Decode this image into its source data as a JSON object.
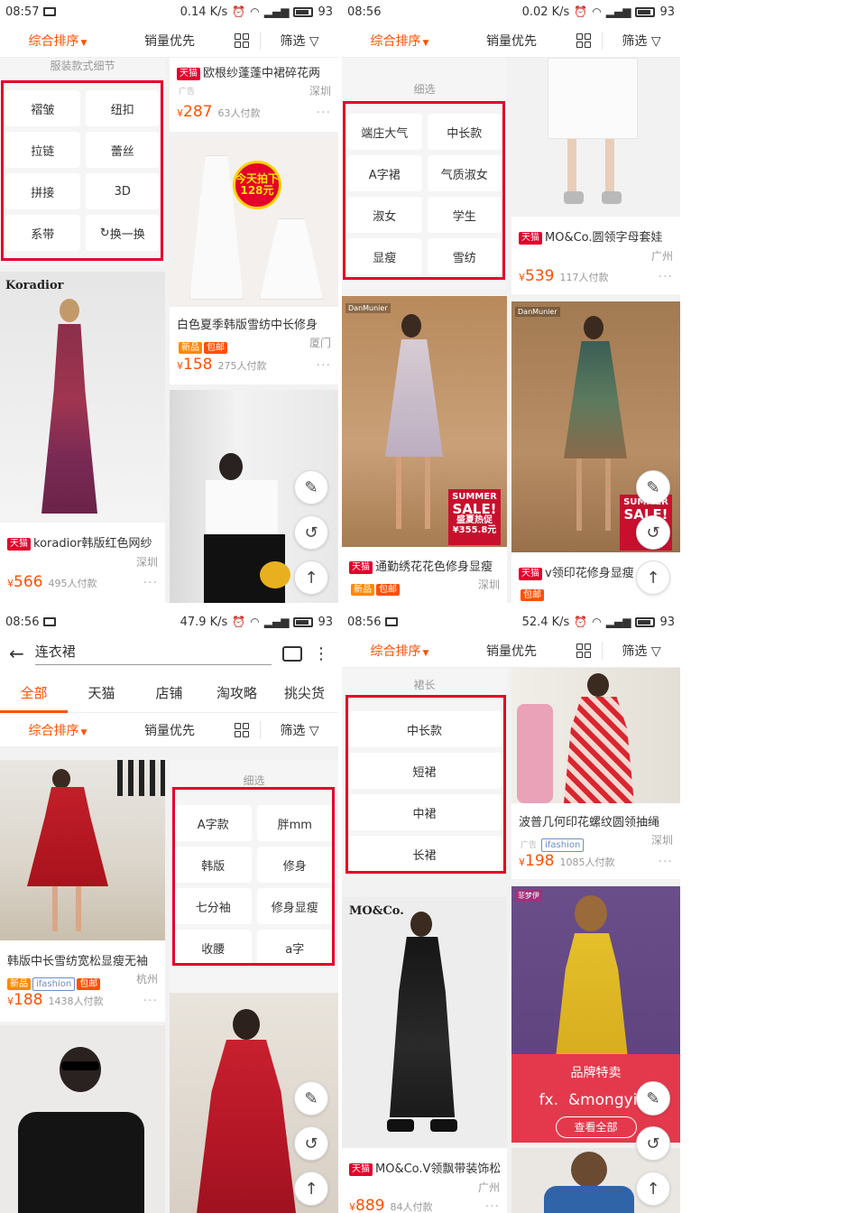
{
  "common": {
    "sort_default": "综合排序",
    "sort_sales": "销量优先",
    "filter": "筛选",
    "colors": {
      "accent": "#ff5000",
      "frame": "#e4002b",
      "tmall": "#e4002b"
    }
  },
  "panel1": {
    "time": "08:57",
    "net": "0.14 K/s",
    "battery": "93",
    "filter_title": "服装款式细节",
    "chips": [
      "褶皱",
      "纽扣",
      "拉链",
      "蕾丝",
      "拼接",
      "3D",
      "系带",
      "换一换"
    ],
    "products": [
      {
        "title": "欧根纱蓬蓬中裙碎花两",
        "tmall": "天猫",
        "ad": "广告",
        "loc": "深圳",
        "price": "287",
        "sold": "63人付款"
      },
      {
        "title": "白色夏季韩版雪纺中长修身",
        "tags": [
          "新品",
          "包邮"
        ],
        "loc": "厦门",
        "price": "158",
        "sold": "275人付款",
        "badge_l1": "今天拍下",
        "badge_l2": "128元"
      },
      {
        "title": "koradior韩版红色网纱",
        "tmall": "天猫",
        "loc": "深圳",
        "price": "566",
        "sold": "495人付款",
        "logo": "Koradior"
      },
      {
        "title": "",
        "loc": ""
      }
    ]
  },
  "panel2": {
    "time": "08:56",
    "net": "0.02 K/s",
    "battery": "93",
    "filter_title": "细选",
    "chips": [
      "端庄大气",
      "中长款",
      "A字裙",
      "气质淑女",
      "淑女",
      "学生",
      "显瘦",
      "雪纺"
    ],
    "products": [
      {
        "title": "MO&Co.圆领字母套娃",
        "tmall": "天猫",
        "loc": "广州",
        "price": "539",
        "sold": "117人付款"
      },
      {
        "title": "通勤绣花花色修身显瘦",
        "tmall": "天猫",
        "tags": [
          "新品",
          "包邮"
        ],
        "loc": "深圳",
        "logo": "DanMunier",
        "sale_l1": "SUMMER",
        "sale_l2": "SALE!",
        "sale_l3": "盛夏热促",
        "sale_price": "¥355.8元"
      },
      {
        "title": "v领印花修身显瘦",
        "tmall": "天猫",
        "tags": [
          "包邮"
        ],
        "logo": "DanMunier",
        "sale_l1": "SUMMER",
        "sale_l2": "SALE!",
        "sale_l3": "盛",
        "sale_price": "¥34"
      }
    ]
  },
  "panel3": {
    "time": "08:56",
    "net": "47.9 K/s",
    "battery": "93",
    "query": "连衣裙",
    "tabs": [
      "全部",
      "天猫",
      "店铺",
      "淘攻略",
      "挑尖货"
    ],
    "filter_title": "细选",
    "chips": [
      "A字款",
      "胖mm",
      "韩版",
      "修身",
      "七分袖",
      "修身显瘦",
      "收腰",
      "a字"
    ],
    "products": [
      {
        "title": "韩版中长雪纺宽松显瘦无袖",
        "tags": [
          "新品",
          "ifashion",
          "包邮"
        ],
        "loc": "杭州",
        "price": "188",
        "sold": "1438人付款"
      }
    ]
  },
  "panel4": {
    "time": "08:56",
    "net": "52.4 K/s",
    "battery": "93",
    "filter_title": "裙长",
    "chips": [
      "中长款",
      "短裙",
      "中裙",
      "长裙"
    ],
    "products": [
      {
        "title": "波普几何印花螺纹圆领抽绳",
        "ad": "广告",
        "tags": [
          "ifashion"
        ],
        "loc": "深圳",
        "price": "198",
        "sold": "1085人付款"
      },
      {
        "title": "MO&Co.V领飘带装饰松",
        "tmall": "天猫",
        "loc": "广州",
        "price": "889",
        "sold": "84人付款",
        "logo": "MO&Co."
      },
      {
        "logo": "菲梦伊",
        "brand_title": "品牌特卖",
        "brand_names": "fx.  &mongyi连",
        "brand_btn": "查看全部"
      }
    ]
  },
  "icons": [
    "message-icon",
    "alarm-icon",
    "wifi-icon",
    "signal-icon",
    "battery-icon",
    "grid-view-icon",
    "filter-funnel-icon",
    "refresh-icon",
    "edit-note-icon",
    "shake-icon",
    "back-to-top-icon",
    "back-arrow-icon",
    "camera-icon",
    "more-vertical-icon"
  ]
}
